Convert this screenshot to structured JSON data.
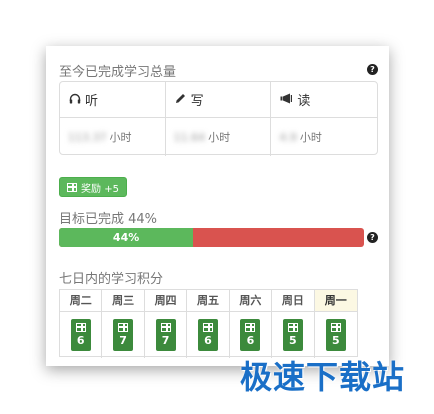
{
  "totals": {
    "title": "至今已完成学习总量",
    "columns": [
      {
        "icon": "headphones-icon",
        "label": "听",
        "value": "113.37",
        "unit": "小时"
      },
      {
        "icon": "pencil-icon",
        "label": "写",
        "value": "11.64",
        "unit": "小时"
      },
      {
        "icon": "megaphone-icon",
        "label": "读",
        "value": "4.9",
        "unit": "小时"
      }
    ]
  },
  "reward": {
    "label": "奖励 +5"
  },
  "goal": {
    "title": "目标已完成 44%",
    "percent_label": "44%",
    "percent": 44
  },
  "week": {
    "title": "七日内的学习积分",
    "days": [
      {
        "name": "周二",
        "score": "6"
      },
      {
        "name": "周三",
        "score": "7"
      },
      {
        "name": "周四",
        "score": "7"
      },
      {
        "name": "周五",
        "score": "6"
      },
      {
        "name": "周六",
        "score": "6"
      },
      {
        "name": "周日",
        "score": "5"
      },
      {
        "name": "周一",
        "score": "5"
      }
    ]
  },
  "watermark": "极速下载站",
  "colors": {
    "success": "#5cb85c",
    "danger": "#d9534f",
    "today": "#fcf8e3",
    "score_bg": "#3c8a3c"
  }
}
